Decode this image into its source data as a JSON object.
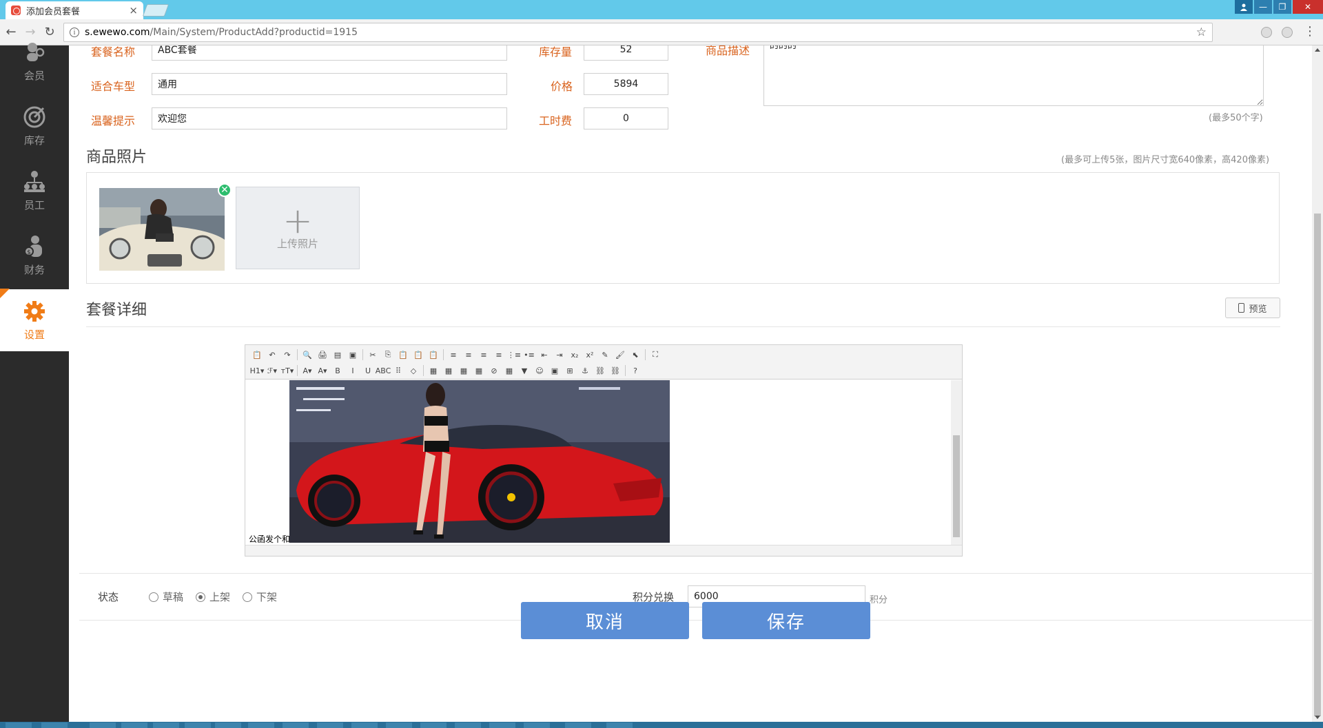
{
  "browser": {
    "tab_title": "添加会员套餐",
    "tab_close": "×",
    "url_host": "s.ewewo.com",
    "url_path": "/Main/System/ProductAdd?productid=1915",
    "win_minimize": "—",
    "win_restore": "❐",
    "win_close": "✕",
    "info_icon": "i",
    "star": "☆",
    "menu": "⋮"
  },
  "sidebar": {
    "items": [
      {
        "label": "会员",
        "icon": "member-icon"
      },
      {
        "label": "库存",
        "icon": "target-icon"
      },
      {
        "label": "员工",
        "icon": "org-chart-icon"
      },
      {
        "label": "财务",
        "icon": "money-bag-icon"
      },
      {
        "label": "设置",
        "icon": "gear-icon",
        "active": true
      }
    ]
  },
  "form": {
    "name_label": "套餐名称",
    "name_value": "ABC套餐",
    "stock_label": "库存量",
    "stock_value": "52",
    "desc_label": "商品描述",
    "desc_value": "的的的",
    "desc_hint": "(最多50个字)",
    "car_label": "适合车型",
    "car_value": "通用",
    "price_label": "价格",
    "price_value": "5894",
    "tip_label": "温馨提示",
    "tip_value": "欢迎您",
    "labor_label": "工时费",
    "labor_value": "0"
  },
  "photos": {
    "title": "商品照片",
    "hint": "(最多可上传5张，图片尺寸宽640像素，高420像素)",
    "delete_icon": "✕",
    "upload_plus": "+",
    "upload_label": "上传照片"
  },
  "details": {
    "title": "套餐详细",
    "preview_label": "预览",
    "editor_text": "公函发个和"
  },
  "toolbar": {
    "row1": [
      "📋",
      "↶",
      "↷",
      "|",
      "🔍",
      "🖨",
      "▤",
      "▣",
      "|",
      "✂",
      "⎘",
      "📋",
      "📋",
      "📋",
      "|",
      "≡",
      "≡",
      "≡",
      "≡",
      "⋮≡",
      "•≡",
      "⇤",
      "⇥",
      "x₂",
      "x²",
      "✎",
      "🖌",
      "⬉",
      "|",
      "⛶"
    ],
    "row2": [
      "H1▾",
      "ℱ▾",
      "тT▾",
      "|",
      "A▾",
      "A▾",
      "B",
      "I",
      "U",
      "ABC",
      "⠿",
      "◇",
      "|",
      "▦",
      "▦",
      "▦",
      "▦",
      "⊘",
      "▦",
      "▼",
      "☺",
      "▣",
      "⊞",
      "⚓",
      "⛓",
      "⛓",
      "|",
      "?"
    ]
  },
  "status": {
    "label": "状态",
    "options": [
      "草稿",
      "上架",
      "下架"
    ],
    "selected": "上架",
    "points_label": "积分兑换",
    "points_value": "6000",
    "points_unit": "积分"
  },
  "actions": {
    "cancel": "取消",
    "save": "保存"
  },
  "colors": {
    "accent_orange": "#f07c17",
    "label_orange": "#d9631e",
    "button_blue": "#5b8ed6",
    "sidebar_bg": "#2b2b2b",
    "chrome_blue": "#62c9ea"
  }
}
